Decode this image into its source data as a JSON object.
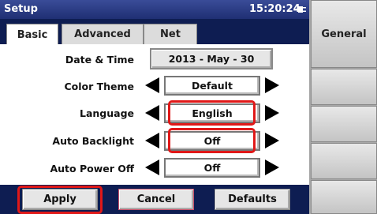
{
  "window": {
    "title": "Setup",
    "clock": "15:20:24",
    "power_icon": "ac-plug-icon"
  },
  "tabs": [
    {
      "label": "Basic",
      "active": true
    },
    {
      "label": "Advanced",
      "active": false
    },
    {
      "label": "Net",
      "active": false
    }
  ],
  "settings": {
    "date_time": {
      "label": "Date & Time",
      "value": "2013 - May - 30"
    },
    "color_theme": {
      "label": "Color Theme",
      "value": "Default"
    },
    "language": {
      "label": "Language",
      "value": "English"
    },
    "auto_backlight": {
      "label": "Auto Backlight",
      "value": "Off"
    },
    "auto_power_off": {
      "label": "Auto Power Off",
      "value": "Off"
    }
  },
  "buttons": {
    "apply": "Apply",
    "cancel": "Cancel",
    "defaults": "Defaults"
  },
  "side_menu": {
    "items": [
      "General",
      "",
      "",
      "",
      ""
    ]
  },
  "colors": {
    "header_blue": "#0e1d52",
    "highlight_red": "#e01818"
  }
}
